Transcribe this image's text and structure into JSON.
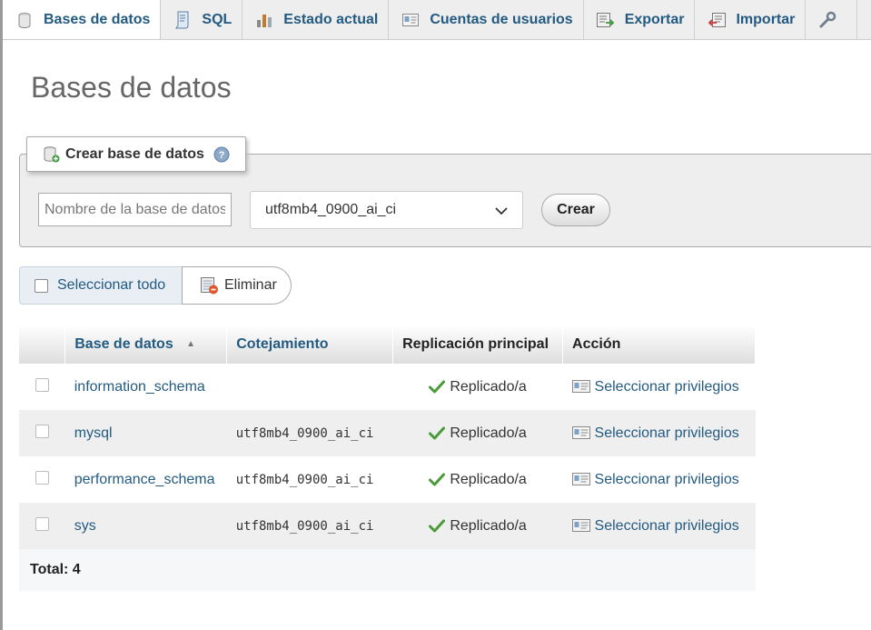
{
  "tabs": [
    {
      "label": "Bases de datos",
      "icon": "database-icon",
      "active": true
    },
    {
      "label": "SQL",
      "icon": "sql-icon",
      "active": false
    },
    {
      "label": "Estado actual",
      "icon": "status-chart-icon",
      "active": false
    },
    {
      "label": "Cuentas de usuarios",
      "icon": "user-accounts-icon",
      "active": false
    },
    {
      "label": "Exportar",
      "icon": "export-icon",
      "active": false
    },
    {
      "label": "Importar",
      "icon": "import-icon",
      "active": false
    },
    {
      "label": "",
      "icon": "wrench-icon",
      "active": false
    }
  ],
  "page": {
    "title": "Bases de datos"
  },
  "create": {
    "legend": "Crear base de datos",
    "name_placeholder": "Nombre de la base de datos",
    "collation_selected": "utf8mb4_0900_ai_ci",
    "button": "Crear"
  },
  "bulk": {
    "select_all": "Seleccionar todo",
    "delete": "Eliminar"
  },
  "table": {
    "headers": {
      "name": "Base de datos",
      "collation": "Cotejamiento",
      "replication": "Replicación principal",
      "action": "Acción"
    },
    "sort": "ascending",
    "rows": [
      {
        "name": "information_schema",
        "collation": "",
        "replication": "Replicado/a",
        "action": "Seleccionar privilegios"
      },
      {
        "name": "mysql",
        "collation": "utf8mb4_0900_ai_ci",
        "replication": "Replicado/a",
        "action": "Seleccionar privilegios"
      },
      {
        "name": "performance_schema",
        "collation": "utf8mb4_0900_ai_ci",
        "replication": "Replicado/a",
        "action": "Seleccionar privilegios"
      },
      {
        "name": "sys",
        "collation": "utf8mb4_0900_ai_ci",
        "replication": "Replicado/a",
        "action": "Seleccionar privilegios"
      }
    ],
    "total": "Total: 4"
  },
  "colors": {
    "link": "#235a81",
    "title": "#666666",
    "tab_bar": "#eeeeee"
  }
}
